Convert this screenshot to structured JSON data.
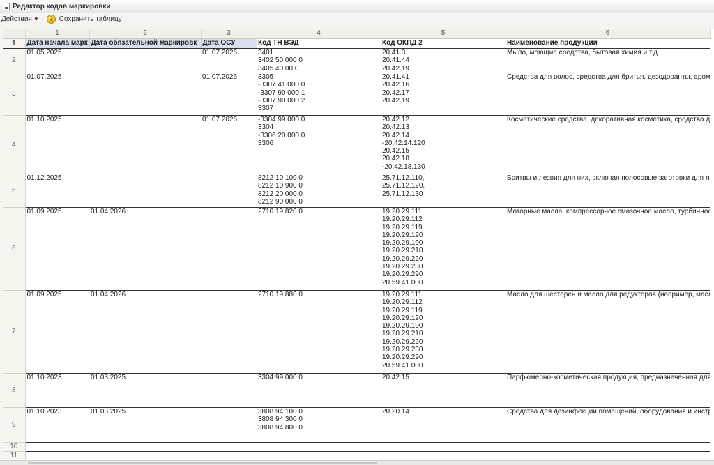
{
  "window": {
    "title": "Редактор кодов маркировки"
  },
  "toolbar": {
    "actions_label": "Действия",
    "save_label": "Сохранить таблицу"
  },
  "columns": [
    "1",
    "2",
    "3",
    "4",
    "5",
    "6"
  ],
  "headers": [
    "Дата начала марк",
    "Дата обязательной маркировк",
    "Дата ОСУ",
    "Код ТН ВЭД",
    "Код ОКПД 2",
    "Наименование продукции"
  ],
  "rows": [
    {
      "num": "2",
      "c1": "01.05.2025",
      "c2": "",
      "c3": "01.07.2026",
      "c4": [
        "3401",
        "3402 50 000 0",
        "3405 40 00 0"
      ],
      "c5": [
        "20.41.3",
        "20.41.44",
        "20.42.19"
      ],
      "c6": "Мыло, моющие средства, бытовая химия и т.д."
    },
    {
      "num": "3",
      "c1": "01.07.2025",
      "c2": "",
      "c3": "01.07.2026",
      "c4": [
        "3305",
        "-3307 41 000 0",
        "-3307 90 000 1",
        "-3307 90 000 2",
        "3307"
      ],
      "c5": [
        "20.41.41",
        "20.42.16",
        "20.42.17",
        "20.42.19"
      ],
      "c6": "Средства для волос, средства для бритья, дезодоранты, ароматизаторы и т.д."
    },
    {
      "num": "4",
      "c1": "01.10.2025",
      "c2": "",
      "c3": "01.07.2026",
      "c4": [
        "-3304 99 000 0",
        "3304",
        "-3306 20 000 0",
        "3306"
      ],
      "c5": [
        "20.42.12",
        "20.42.13",
        "20.42.14",
        "-20.42.14.120",
        "20.42.15",
        "20.42.18",
        "-20.42.18.130"
      ],
      "c6": "Косметические средства, декоративная косметика, средства для ухода за полостью рта и т.д."
    },
    {
      "num": "5",
      "c1": "01.12.2025",
      "c2": "",
      "c3": "",
      "c4": [
        "8212 10 100 0",
        "8212 10 900 0",
        "8212 20 000 0",
        "8212 90 000 0"
      ],
      "c5": [
        "25.71.12.110,",
        "25.71.12.120,",
        "25.71.12.130"
      ],
      "c6": "Бритвы и лезвия для них, включая полосовые заготовки для лезвий"
    },
    {
      "num": "6",
      "c1": "01.09.2025",
      "c2": "01.04.2026",
      "c3": "",
      "c4": [
        "2710 19 820 0"
      ],
      "c5": [
        "19.20.29.111",
        "19.20.29.112",
        "19.20.29.119",
        "19.20.29.120",
        "19.20.29.190",
        "19.20.29.210",
        "19.20.29.220",
        "19.20.29.230",
        "19.20.29.290",
        "20.59.41.000"
      ],
      "c6": "Моторные масла, компрессорное смазочное масло, турбинное смазочное масло (например, универсальные, синтетические, полусинтетические, минеральные, всесезонные)"
    },
    {
      "num": "7",
      "c1": "01.09.2025",
      "c2": "01.04.2026",
      "c3": "",
      "c4": [
        "2710 19 880 0"
      ],
      "c5": [
        "19.20.29.111",
        "19.20.29.112",
        "19.20.29.119",
        "19.20.29.120",
        "19.20.29.190",
        "19.20.29.210",
        "19.20.29.220",
        "19.20.29.230",
        "19.20.29.290",
        "20.59.41.000"
      ],
      "c6": "Масло для шестерен и масло для редукторов (например, масло трансмиссионное)"
    },
    {
      "num": "8",
      "c1": "01.10.2023",
      "c2": "01.03.2025",
      "c3": "",
      "c4": [
        "3304 99 000 0"
      ],
      "c5": [
        "20.42.15"
      ],
      "c6": "Парфюмерно-косметическая продукция, предназначенная для гигиены рук, с заявленным в маркировке потребительской упаковки антимикробным действием"
    },
    {
      "num": "9",
      "c1": "01.10.2023",
      "c2": "01.03.2025",
      "c3": "",
      "c4": [
        "3808 94 100 0",
        "3808 94 300 0",
        "3808 94 800 0"
      ],
      "c5": [
        "20.20.14"
      ],
      "c6": "Средства для дезинфекции помещений, оборудования и инструментов, одежды и белья (за исключением средств для ветеринарного применения) и кожные антисептики"
    }
  ],
  "empty_rows": [
    "10",
    "11"
  ]
}
